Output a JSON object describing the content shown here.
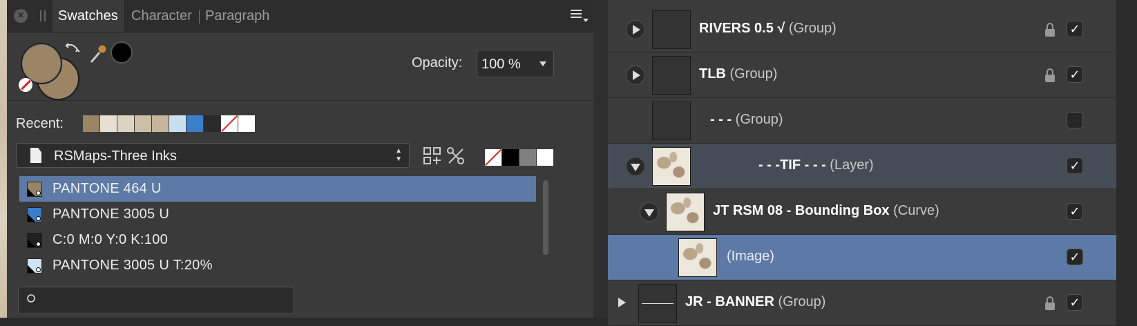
{
  "swatches_panel": {
    "tabs": [
      {
        "label": "Swatches",
        "active": true
      },
      {
        "label": "Character",
        "active": false
      },
      {
        "label": "Paragraph",
        "active": false
      }
    ],
    "close_glyph": "×",
    "fill_color": "#9b8565",
    "stroke_color": "#9b8565",
    "opacity_label": "Opacity:",
    "opacity_value": "100 %",
    "recent_label": "Recent:",
    "recent_colors": [
      "#9b8565",
      "#e6dfd2",
      "#ddd3c2",
      "#cbbfa8",
      "#c6b59c",
      "#c7dff0",
      "#3a7dc8",
      "#2a2a2a",
      "none",
      "#ffffff"
    ],
    "palette_name": "RSMaps-Three Inks",
    "palette_updown": "▲\n▼",
    "document_colors": [
      "none",
      "#000000",
      "#808080",
      "#ffffff"
    ],
    "swatches": [
      {
        "label": "PANTONE 464 U",
        "color": "#9b8565",
        "selected": true
      },
      {
        "label": "PANTONE 3005 U",
        "color": "#3a7dc8",
        "selected": false
      },
      {
        "label": "C:0 M:0 Y:0 K:100",
        "color": "#1f1f1f",
        "selected": false
      },
      {
        "label": "PANTONE 3005 U T:20%",
        "color": "#cfe3f3",
        "selected": false
      }
    ],
    "search_placeholder": ""
  },
  "layers_panel": {
    "check_glyph": "✓",
    "layers": [
      {
        "name": "RIVERS  0.5  √",
        "type": "(Group)",
        "locked": true,
        "visible": true
      },
      {
        "name": "TLB",
        "type": "(Group)",
        "locked": true,
        "visible": true
      },
      {
        "name": "- - -",
        "type": "(Group)",
        "locked": false,
        "visible": false
      },
      {
        "name": "- - -TIF - - -",
        "type": "(Layer)",
        "locked": false,
        "visible": true
      },
      {
        "name": "JT RSM 08 - Bounding Box",
        "type": "(Curve)",
        "locked": false,
        "visible": true
      },
      {
        "name": "",
        "type": "(Image)",
        "locked": false,
        "visible": true
      },
      {
        "name": "JR - BANNER",
        "type": "(Group)",
        "locked": true,
        "visible": true
      }
    ]
  }
}
